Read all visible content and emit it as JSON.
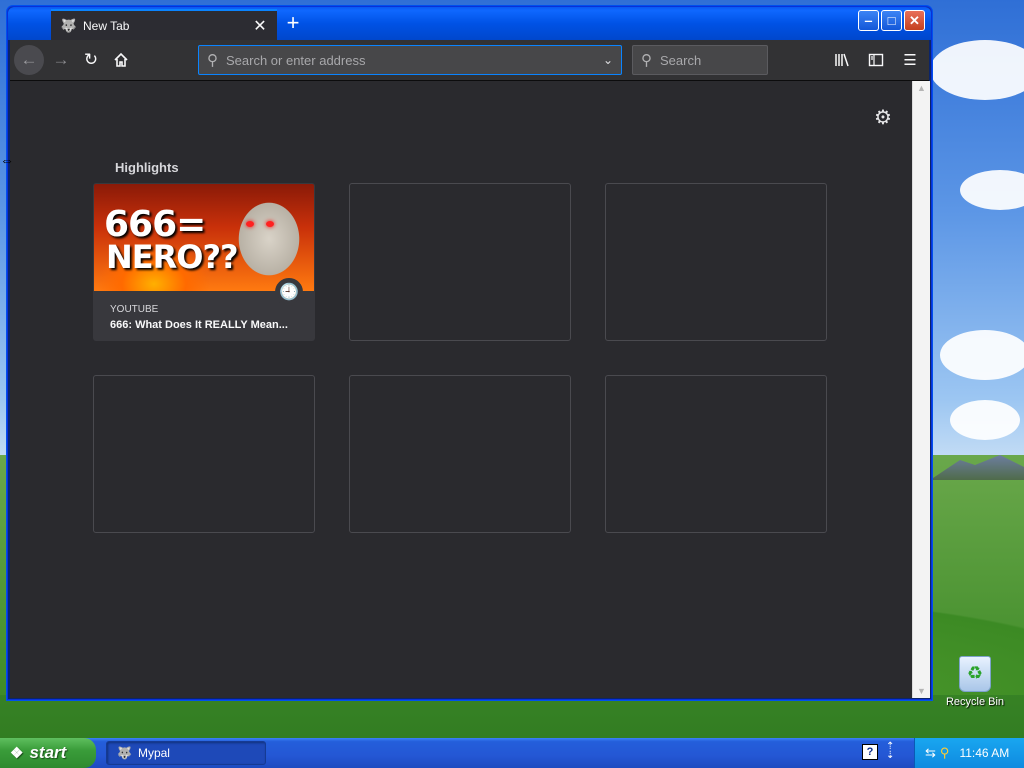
{
  "window": {
    "tab_title": "New Tab",
    "new_tab_symbol": "+",
    "controls": {
      "minimize": "‒",
      "maximize": "□",
      "close": "✕"
    }
  },
  "toolbar": {
    "address_placeholder": "Search or enter address",
    "search_placeholder": "Search"
  },
  "newtab_page": {
    "section_title": "Highlights",
    "highlights": [
      {
        "source": "YOUTUBE",
        "title": "666: What Does It REALLY Mean...",
        "thumbnail_text_line1": "666=",
        "thumbnail_text_line2": "NERO??"
      }
    ],
    "empty_slots": 5
  },
  "desktop": {
    "recycle_bin_label": "Recycle Bin"
  },
  "taskbar": {
    "start_label": "start",
    "task_item_label": "Mypal",
    "clock": "11:46 AM"
  },
  "icons": [
    "back-arrow-icon",
    "forward-arrow-icon",
    "reload-icon",
    "home-icon",
    "search-icon",
    "chevron-down-icon",
    "library-icon",
    "sidebar-icon",
    "menu-icon",
    "gear-icon",
    "clock-icon",
    "windows-flag-icon",
    "recycle-bin-icon"
  ],
  "colors": {
    "accent": "#0a84ff",
    "content_bg": "#2a2a2e",
    "toolbar_bg": "#323234"
  }
}
